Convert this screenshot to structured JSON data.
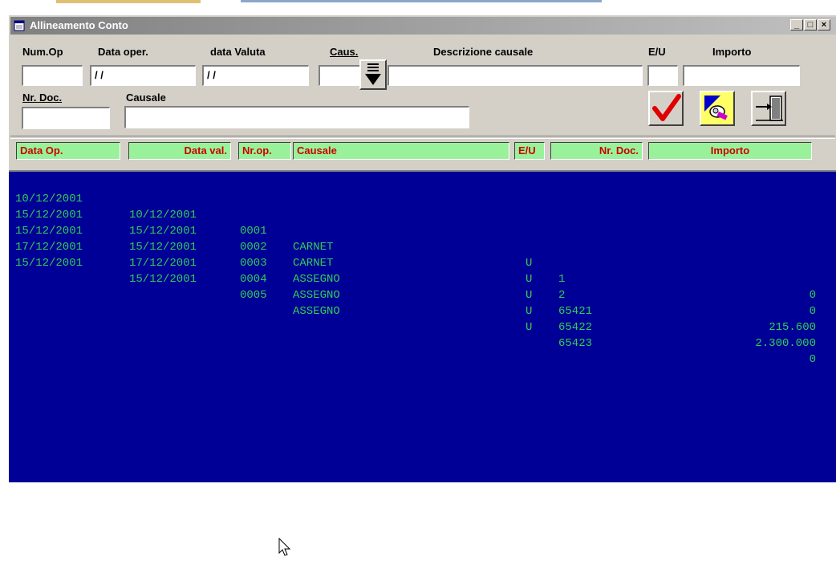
{
  "window": {
    "title": "Allineamento Conto",
    "buttons": {
      "minimize": "_",
      "maximize": "□",
      "close": "×"
    }
  },
  "form": {
    "labels": {
      "num_op": "Num.Op",
      "data_oper": "Data oper.",
      "data_valuta": "data Valuta",
      "caus": "Caus.",
      "descrizione_causale": "Descrizione causale",
      "eu": "E/U",
      "importo": "Importo",
      "nr_doc": "Nr. Doc.",
      "causale": "Causale"
    },
    "values": {
      "num_op": "",
      "data_oper": "/ /",
      "data_valuta": "/ /",
      "caus": "",
      "descrizione_causale": "",
      "eu": "",
      "importo": "",
      "nr_doc": "",
      "causale": ""
    }
  },
  "actions": {
    "confirm": "check-icon",
    "search": "flashlight-icon",
    "exit": "exit-door-icon"
  },
  "grid": {
    "headers": [
      "Data Op.",
      "Data val.",
      "Nr.op.",
      "Causale",
      "E/U",
      "Nr. Doc.",
      "Importo"
    ],
    "rows": [
      {
        "data_op": "10/12/2001",
        "data_val": "10/12/2001",
        "nr_op": "0001",
        "causale": "CARNET",
        "eu": "U",
        "nr_doc": "1",
        "importo": "0"
      },
      {
        "data_op": "15/12/2001",
        "data_val": "15/12/2001",
        "nr_op": "0002",
        "causale": "CARNET",
        "eu": "U",
        "nr_doc": "2",
        "importo": "0"
      },
      {
        "data_op": "15/12/2001",
        "data_val": "15/12/2001",
        "nr_op": "0003",
        "causale": "ASSEGNO",
        "eu": "U",
        "nr_doc": "65421",
        "importo": "215.600"
      },
      {
        "data_op": "17/12/2001",
        "data_val": "17/12/2001",
        "nr_op": "0004",
        "causale": "ASSEGNO",
        "eu": "U",
        "nr_doc": "65422",
        "importo": "2.300.000"
      },
      {
        "data_op": "15/12/2001",
        "data_val": "15/12/2001",
        "nr_op": "0005",
        "causale": "ASSEGNO",
        "eu": "U",
        "nr_doc": "65423",
        "importo": "0"
      }
    ]
  },
  "colors": {
    "list_bg": "#000096",
    "list_text": "#33cc55",
    "header_bg": "#99f299",
    "header_text": "#cc0000"
  }
}
